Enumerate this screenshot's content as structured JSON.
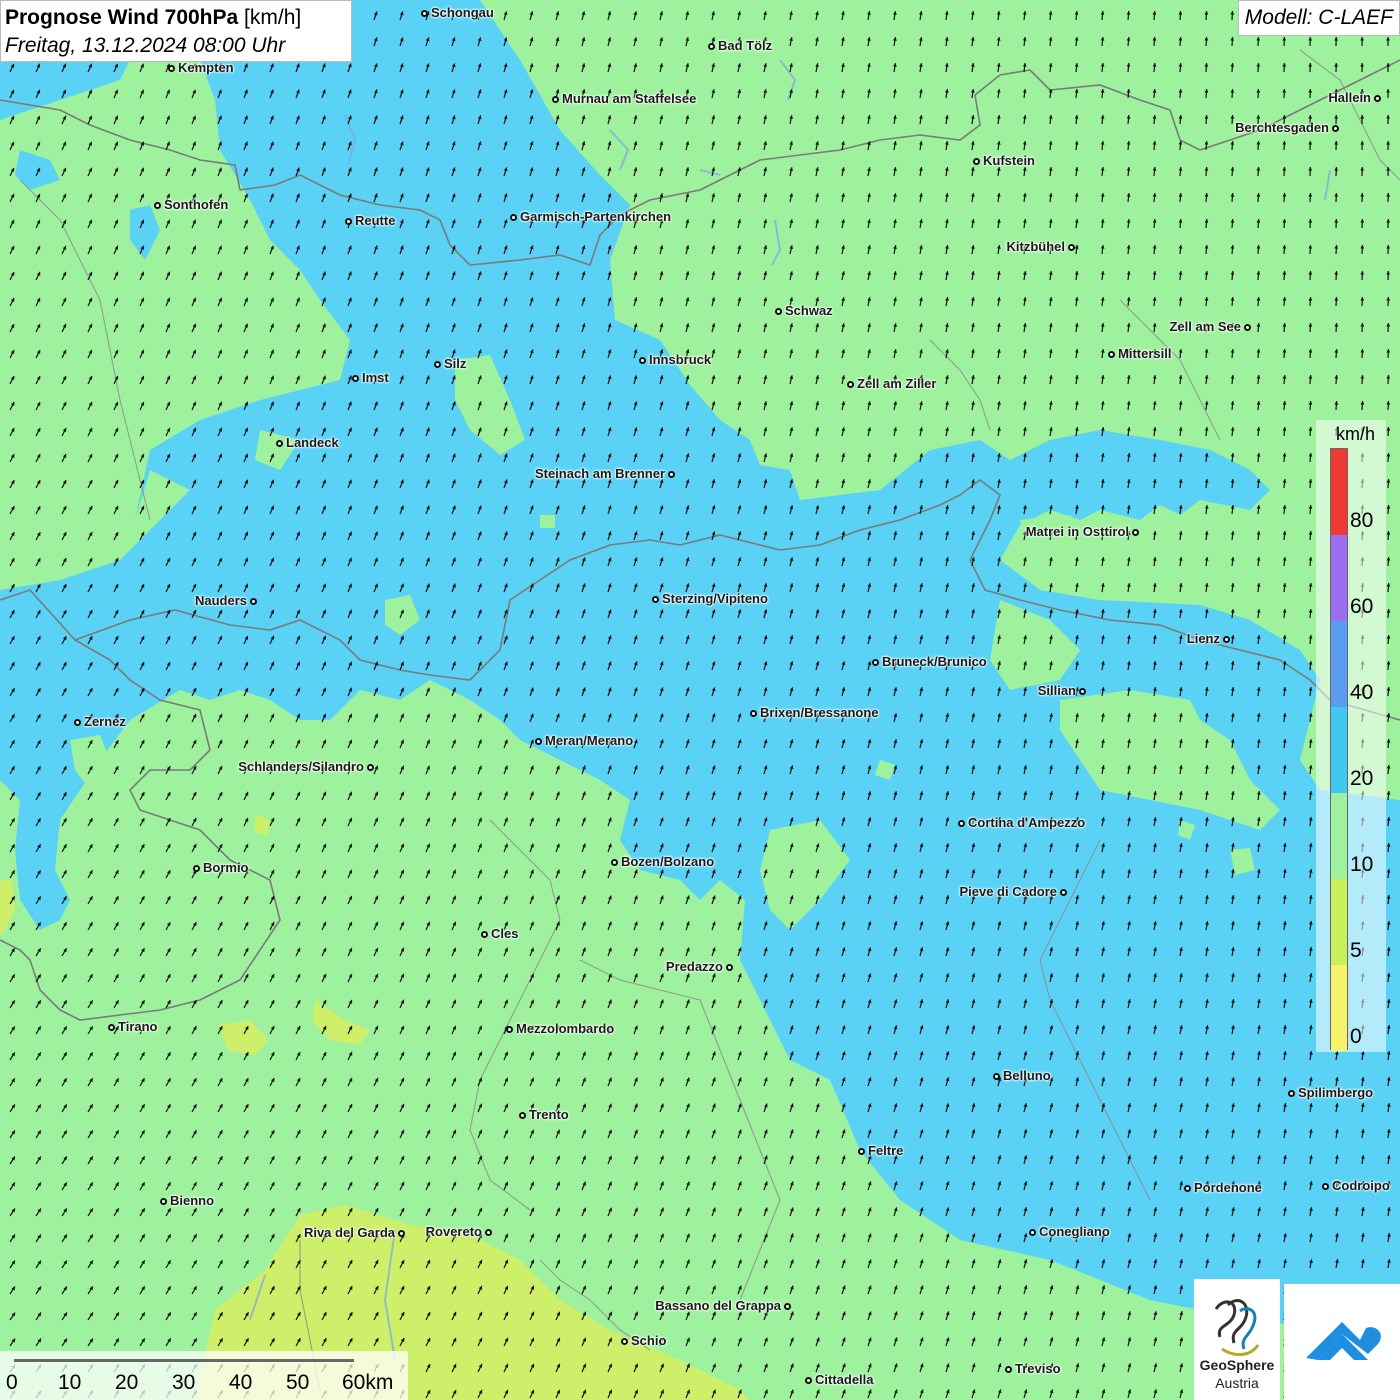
{
  "title": {
    "main_bold": "Prognose Wind 700hPa",
    "unit": " [km/h]",
    "datetime": "Freitag, 13.12.2024 08:00 Uhr"
  },
  "model_label": "Modell: C-LAEF",
  "legend": {
    "unit": "km/h",
    "ticks": [
      "80",
      "60",
      "40",
      "20",
      "10",
      "5",
      "0"
    ],
    "colors": [
      "#ee3a35",
      "#9c6ef0",
      "#5b9cf0",
      "#3fc9f2",
      "#9ef29e",
      "#c8f05a",
      "#f6f26a"
    ]
  },
  "scale": {
    "labels": [
      "0",
      "10",
      "20",
      "30",
      "40",
      "50",
      "60km"
    ]
  },
  "map_colors": {
    "green_10_20": "#9ef29e",
    "blue_20_40": "#5ad2f5",
    "yellow_5_10": "#cdef6a"
  },
  "cities": [
    "Schongau",
    "Bad Tölz",
    "Kempten",
    "Murnau am Staffelsee",
    "Hallein",
    "Berchtesgaden",
    "Kufstein",
    "Sonthofen",
    "Reutte",
    "Garmisch-Partenkirchen",
    "Kitzbühel",
    "Schwaz",
    "Zell am See",
    "Mittersill",
    "Innsbruck",
    "Silz",
    "Imst",
    "Zell am Ziller",
    "Landeck",
    "Steinach am Brenner",
    "Matrei in Osttirol",
    "Nauders",
    "Sterzing/Vipiteno",
    "Lienz",
    "Bruneck/Brunico",
    "Sillian",
    "Zernez",
    "Brixen/Bressanone",
    "Meran/Merano",
    "Schlanders/Silandro",
    "Cortina d'Ampezzo",
    "Bozen/Bolzano",
    "Bormio",
    "Pieve di Cadore",
    "Cles",
    "Predazzo",
    "Tirano",
    "Mezzolombardo",
    "Belluno",
    "Spilimbergo",
    "Trento",
    "Feltre",
    "Pordenone",
    "Codroipo",
    "Bienno",
    "Riva del Garda",
    "Rovereto",
    "Conegliano",
    "Bassano del Grappa",
    "Schio",
    "Treviso",
    "Cittadella"
  ],
  "logo": {
    "line1": "GeoSphere",
    "line2": "Austria"
  },
  "wind_arrow_icon": "wind-arrow-icon"
}
